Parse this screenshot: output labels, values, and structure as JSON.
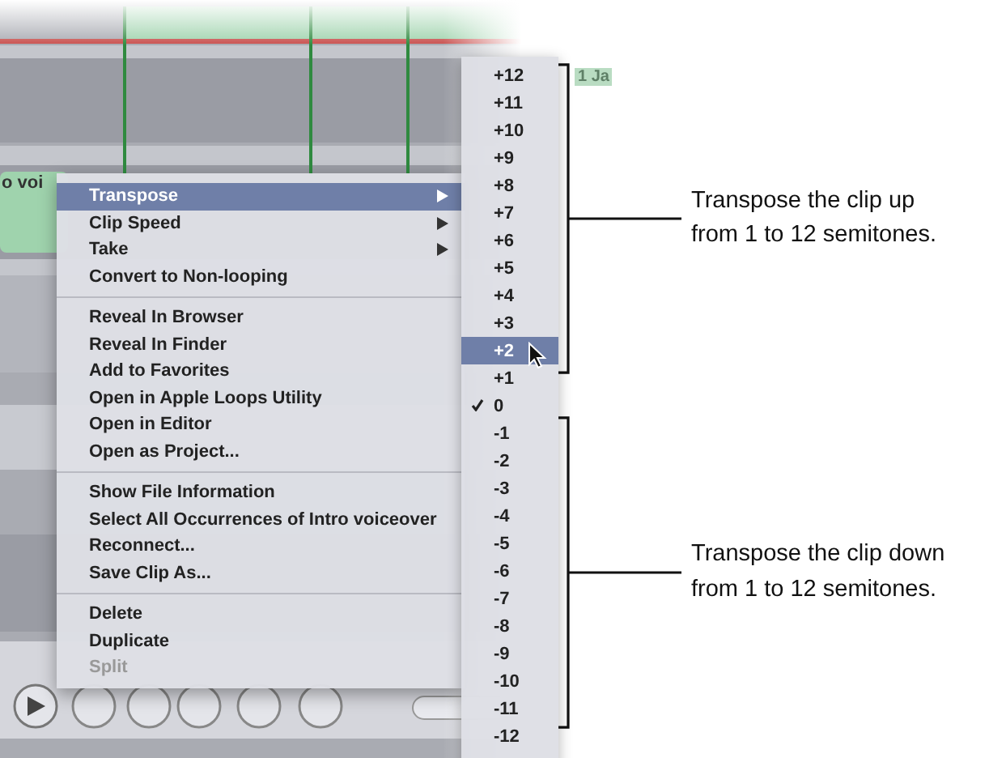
{
  "clip_label": "o voi",
  "region_label": "1 Ja",
  "context_menu": {
    "groups": [
      [
        {
          "label": "Transpose",
          "selected": true,
          "submenu": true,
          "disabled": false
        },
        {
          "label": "Clip Speed",
          "selected": false,
          "submenu": true,
          "disabled": false
        },
        {
          "label": "Take",
          "selected": false,
          "submenu": true,
          "disabled": false
        },
        {
          "label": "Convert to Non-looping",
          "selected": false,
          "submenu": false,
          "disabled": false
        }
      ],
      [
        {
          "label": "Reveal In Browser",
          "selected": false,
          "submenu": false,
          "disabled": false
        },
        {
          "label": "Reveal In Finder",
          "selected": false,
          "submenu": false,
          "disabled": false
        },
        {
          "label": "Add to Favorites",
          "selected": false,
          "submenu": false,
          "disabled": false
        },
        {
          "label": "Open in Apple Loops Utility",
          "selected": false,
          "submenu": false,
          "disabled": false
        },
        {
          "label": "Open in Editor",
          "selected": false,
          "submenu": false,
          "disabled": false
        },
        {
          "label": "Open as Project...",
          "selected": false,
          "submenu": false,
          "disabled": false
        }
      ],
      [
        {
          "label": "Show File Information",
          "selected": false,
          "submenu": false,
          "disabled": false
        },
        {
          "label": "Select All Occurrences of Intro voiceover",
          "selected": false,
          "submenu": false,
          "disabled": false
        },
        {
          "label": "Reconnect...",
          "selected": false,
          "submenu": false,
          "disabled": false
        },
        {
          "label": "Save Clip As...",
          "selected": false,
          "submenu": false,
          "disabled": false
        }
      ],
      [
        {
          "label": "Delete",
          "selected": false,
          "submenu": false,
          "disabled": false
        },
        {
          "label": "Duplicate",
          "selected": false,
          "submenu": false,
          "disabled": false
        },
        {
          "label": "Split",
          "selected": false,
          "submenu": false,
          "disabled": true
        }
      ]
    ]
  },
  "transpose_submenu": [
    {
      "label": "+12",
      "selected": false,
      "checked": false
    },
    {
      "label": "+11",
      "selected": false,
      "checked": false
    },
    {
      "label": "+10",
      "selected": false,
      "checked": false
    },
    {
      "label": "+9",
      "selected": false,
      "checked": false
    },
    {
      "label": "+8",
      "selected": false,
      "checked": false
    },
    {
      "label": "+7",
      "selected": false,
      "checked": false
    },
    {
      "label": "+6",
      "selected": false,
      "checked": false
    },
    {
      "label": "+5",
      "selected": false,
      "checked": false
    },
    {
      "label": "+4",
      "selected": false,
      "checked": false
    },
    {
      "label": "+3",
      "selected": false,
      "checked": false
    },
    {
      "label": "+2",
      "selected": true,
      "checked": false
    },
    {
      "label": "+1",
      "selected": false,
      "checked": false
    },
    {
      "label": "0",
      "selected": false,
      "checked": true
    },
    {
      "label": "-1",
      "selected": false,
      "checked": false
    },
    {
      "label": "-2",
      "selected": false,
      "checked": false
    },
    {
      "label": "-3",
      "selected": false,
      "checked": false
    },
    {
      "label": "-4",
      "selected": false,
      "checked": false
    },
    {
      "label": "-5",
      "selected": false,
      "checked": false
    },
    {
      "label": "-6",
      "selected": false,
      "checked": false
    },
    {
      "label": "-7",
      "selected": false,
      "checked": false
    },
    {
      "label": "-8",
      "selected": false,
      "checked": false
    },
    {
      "label": "-9",
      "selected": false,
      "checked": false
    },
    {
      "label": "-10",
      "selected": false,
      "checked": false
    },
    {
      "label": "-11",
      "selected": false,
      "checked": false
    },
    {
      "label": "-12",
      "selected": false,
      "checked": false
    }
  ],
  "callouts": [
    {
      "text": "Transpose the clip up from 1 to 12 semitones."
    },
    {
      "text": "Transpose the clip down from 1 to 12 semitones."
    }
  ]
}
